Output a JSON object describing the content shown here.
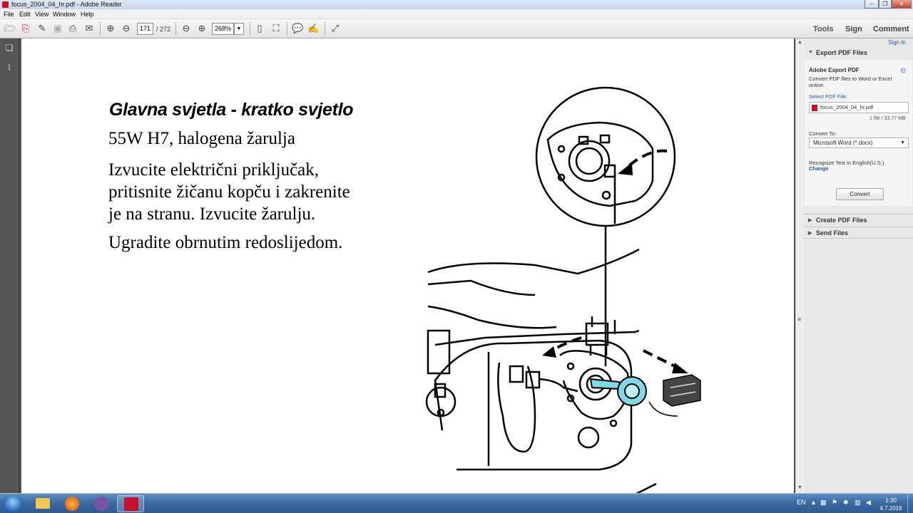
{
  "window": {
    "title": "focus_2004_04_hr.pdf - Adobe Reader"
  },
  "menu": [
    "File",
    "Edit",
    "View",
    "Window",
    "Help"
  ],
  "toolbar": {
    "page_current": "171",
    "page_total": "/ 272",
    "zoom": "268%",
    "tools_label": "Tools",
    "sign_label": "Sign",
    "comment_label": "Comment"
  },
  "document": {
    "heading": "Glavna svjetla - kratko svjetlo",
    "bulb": "55W H7,  halogena žarulja",
    "instructions": [
      "Izvucite električni priključak,",
      "pritisnite žičanu kopču i zakrenite",
      "je na stranu. Izvucite žarulju."
    ],
    "refit": "Ugradite obrnutim redoslijedom."
  },
  "panel": {
    "sign_in": "Sign In",
    "export_section": "Export PDF Files",
    "export_title": "Adobe Export PDF",
    "export_desc": [
      "Convert PDF files to Word or Excel",
      "online."
    ],
    "select_label": "Select PDF File:",
    "file_name": "focus_2004_04_hr.pdf",
    "file_info": "1 file / 33.77 MB",
    "convert_to_label": "Convert To:",
    "convert_to_value": "Microsoft Word (*.docx)",
    "ocr_label": "Recognize Text in English(U.S.)",
    "change_link": "Change",
    "convert_button": "Convert",
    "create_section": "Create PDF Files",
    "send_section": "Send Files"
  },
  "taskbar": {
    "language": "EN",
    "time": "1:30",
    "date": "4.7.2016"
  },
  "colors": {
    "accent_blue": "#1e5ba8",
    "bulb_highlight": "#7fd8e6",
    "adobe_red": "#c8102e"
  }
}
